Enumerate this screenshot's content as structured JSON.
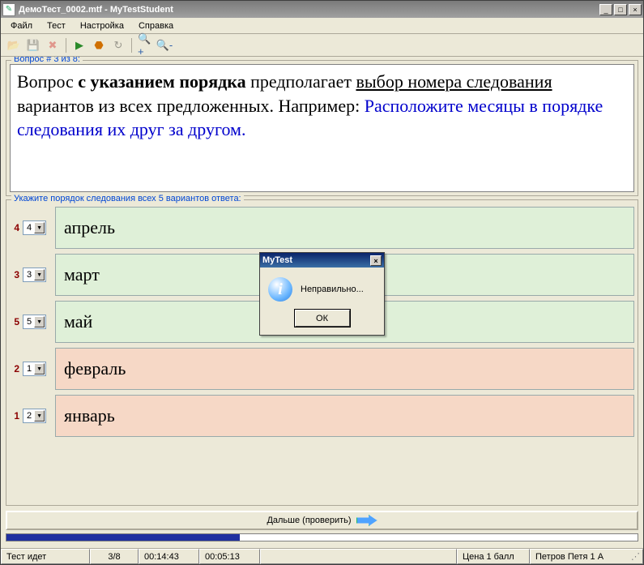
{
  "window": {
    "title": "ДемоТест_0002.mtf - MyTestStudent",
    "controls": {
      "min": "_",
      "max": "□",
      "close": "×"
    }
  },
  "menu": {
    "file": "Файл",
    "test": "Тест",
    "settings": "Настройка",
    "help": "Справка"
  },
  "question_header": "Вопрос # 3 из 8:",
  "question": {
    "p1a": "Вопрос ",
    "p1b": "с указанием порядка",
    "p1c": " предполагает ",
    "p1d": "выбор номера следования",
    "p1e": " вариантов из всех предложенных. Например:",
    "p2": "Расположите месяцы в порядке следования их друг за другом."
  },
  "answers_header": "Укажите порядок следования всех 5 вариантов ответа:",
  "answers": [
    {
      "num": "4",
      "sel": "4",
      "text": "апрель",
      "correct": true
    },
    {
      "num": "3",
      "sel": "3",
      "text": "март",
      "correct": true
    },
    {
      "num": "5",
      "sel": "5",
      "text": "май",
      "correct": true
    },
    {
      "num": "2",
      "sel": "1",
      "text": "февраль",
      "correct": false
    },
    {
      "num": "1",
      "sel": "2",
      "text": "январь",
      "correct": false
    }
  ],
  "next_label": "Дальше (проверить)",
  "status": {
    "s1": "Тест идет",
    "s2": "3/8",
    "s3": "00:14:43",
    "s4": "00:05:13",
    "s5": "",
    "s6": "Цена 1 балл",
    "s7": "Петров Петя 1 А"
  },
  "dialog": {
    "title": "MyTest",
    "message": "Неправильно...",
    "ok": "ОК",
    "close": "×"
  }
}
